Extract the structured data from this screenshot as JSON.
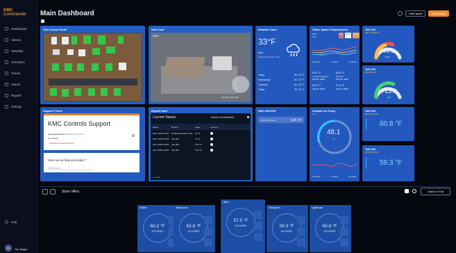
{
  "brand": {
    "name_left": "KMC",
    "name_right": "Commander"
  },
  "header": {
    "title": "Main Dashboard",
    "edit_layout": "Edit Layout",
    "add_widget": "Add Widget"
  },
  "sidebar": {
    "items": [
      "Dashboards",
      "Admins",
      "Networks",
      "Schedules",
      "Trends",
      "Alarms",
      "Reports",
      "Settings"
    ],
    "help": "Help",
    "user": "Tim Magel",
    "user_initials": "TM"
  },
  "cards": {
    "demo": "Tim's Demo Panel",
    "web": "Web Card",
    "web_overlay_left": "05/16",
    "web_overlay_right": "Cam 05 / 09:14:22",
    "weather": {
      "title": "Weather Card",
      "temp": "33°F",
      "desc": "Rain",
      "desc2": "Relative Humidity: 72%",
      "forecast": [
        [
          "Today",
          "26 / 33 °F"
        ],
        [
          "Wednesday",
          "28 / 37 °F"
        ],
        [
          "Thursday",
          "34 / 45 °F"
        ],
        [
          "Friday",
          "33 / 41 °F"
        ]
      ]
    },
    "office": {
      "title": "Office Space Temperatures",
      "tabs": [
        "Real time",
        "Day",
        "Week",
        "Month"
      ],
      "left_temp": "59.3 °F",
      "left_label": "Conference Room",
      "left_status": "SPACE TEMP",
      "right_temp": "60.8 °F",
      "right_label": "Vav 002",
      "right_status": "SPACE TEMP",
      "times": [
        "1/1 12am",
        "1/1 6am",
        "1/1 12pm"
      ],
      "bottom_left": "62.8 °F",
      "bottom_right": "57.5 °F",
      "bottom_left_label": "SPACE TEMP",
      "bottom_right_label": "SPACE TEMP"
    },
    "vav1": {
      "title": "VAV-201",
      "sub": "REL HUMIDITY",
      "value": "44.0",
      "unit": "%RH"
    },
    "vav2": {
      "title": "VAV-201",
      "sub": "ROOM CO2",
      "value": "713.0",
      "unit": "ppm"
    },
    "support": {
      "title": "Support Ticket",
      "heading": "KMC Controls Support",
      "email": "fangel.tek@gmail.com",
      "switch": "Switch account",
      "not_shared": "Not shared",
      "required": "* Indicates required question",
      "question": "How can we help you today? *",
      "answer": "Your answer"
    },
    "report": {
      "title": "Report Card",
      "subtitle": "Current Values",
      "search": "Search on Point/Device",
      "columns": [
        "Name",
        "Device",
        "Value",
        "Actions"
      ],
      "rows": [
        [
          "ACT COOL STPT",
          "Conference Room 201",
          "72 °F"
        ],
        [
          "ACT COOL STPT",
          "Vav 002",
          "72 °F"
        ],
        [
          "ACT COOL STPT",
          "Vav 003",
          "73.5 °F"
        ],
        [
          "ACT COOL STPT",
          "Vav 004",
          "74.0 °F"
        ]
      ],
      "page": "1-4 of 4"
    },
    "device": {
      "title": "KMC-DEVICE",
      "label": "Lab Lights Status",
      "value": "Both Off"
    },
    "outside": {
      "title": "Outside Air Temp",
      "label": "OAT",
      "value": "48.1",
      "unit": "°F"
    },
    "vav3": {
      "title": "VAV-002",
      "sub": "SPACE TEMP",
      "value": "60.8 °F"
    },
    "vav4": {
      "title": "VAV-001",
      "sub": "SPACE TEMP",
      "value": "59.3 °F"
    }
  },
  "store": {
    "title": "Store VAVs",
    "switch": "Switch to Flat",
    "units": [
      {
        "name": "Kitchen",
        "temp": "60.2 °F",
        "state": "OCCUPIED"
      },
      {
        "name": "Washrooms",
        "temp": "62.8 °F",
        "state": "OCCUPIED"
      },
      {
        "name": "Office",
        "temp": "57.5 °F",
        "state": "OCCUPIED"
      },
      {
        "name": "Dining Area",
        "temp": "59.3 °F",
        "state": "OCCUPIED"
      },
      {
        "name": "Lighthouse",
        "temp": "60.8 °F",
        "state": "OCCUPIED"
      }
    ]
  },
  "colors": {
    "accent": "#1b56b8",
    "orange": "#f08a2c",
    "green": "#53d36a",
    "red": "#ff5a4d",
    "yellow": "#f2c24d"
  }
}
